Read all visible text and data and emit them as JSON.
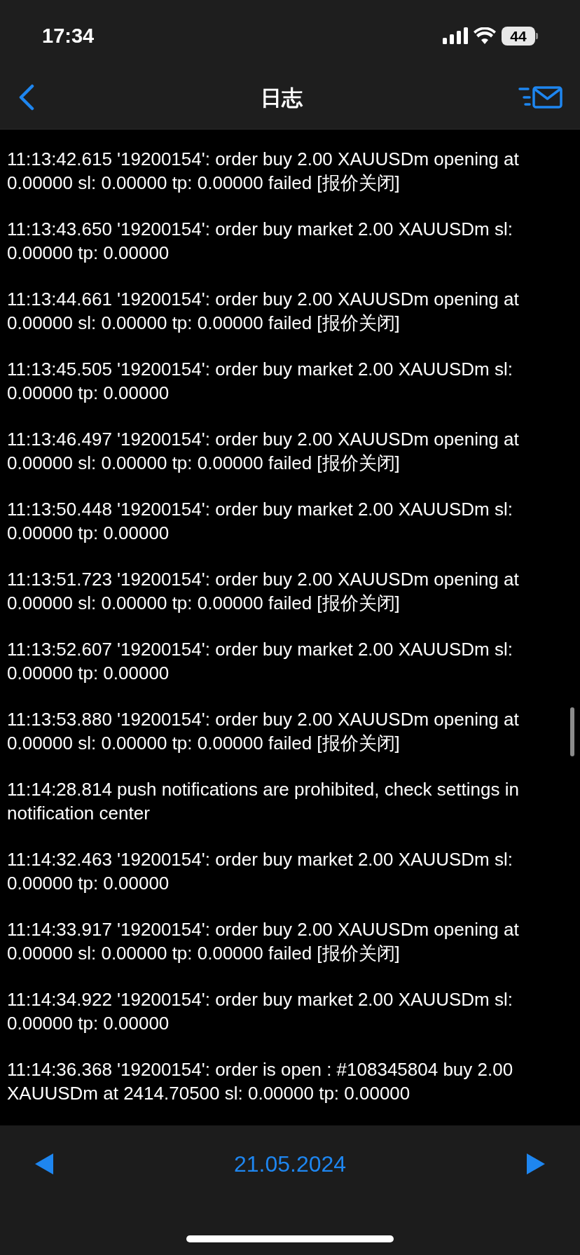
{
  "status_bar": {
    "time": "17:34",
    "battery": "44"
  },
  "nav": {
    "title": "日志"
  },
  "log": [
    {
      "text": "11:13:42.615 '19200154': order buy 2.00 XAUUSDm opening at 0.00000 sl: 0.00000 tp: 0.00000 failed [报价关闭]"
    },
    {
      "text": "11:13:43.650 '19200154': order buy market 2.00 XAUUSDm sl: 0.00000 tp: 0.00000"
    },
    {
      "text": "11:13:44.661 '19200154': order buy 2.00 XAUUSDm opening at 0.00000 sl: 0.00000 tp: 0.00000 failed [报价关闭]"
    },
    {
      "text": "11:13:45.505 '19200154': order buy market 2.00 XAUUSDm sl: 0.00000 tp: 0.00000"
    },
    {
      "text": "11:13:46.497 '19200154': order buy 2.00 XAUUSDm opening at 0.00000 sl: 0.00000 tp: 0.00000 failed [报价关闭]"
    },
    {
      "text": "11:13:50.448 '19200154': order buy market 2.00 XAUUSDm sl: 0.00000 tp: 0.00000"
    },
    {
      "text": "11:13:51.723 '19200154': order buy 2.00 XAUUSDm opening at 0.00000 sl: 0.00000 tp: 0.00000 failed [报价关闭]"
    },
    {
      "text": "11:13:52.607 '19200154': order buy market 2.00 XAUUSDm sl: 0.00000 tp: 0.00000"
    },
    {
      "text": "11:13:53.880 '19200154': order buy 2.00 XAUUSDm opening at 0.00000 sl: 0.00000 tp: 0.00000 failed [报价关闭]"
    },
    {
      "text": "11:14:28.814 push notifications are prohibited, check settings in notification center"
    },
    {
      "text": "11:14:32.463 '19200154': order buy market 2.00 XAUUSDm sl: 0.00000 tp: 0.00000"
    },
    {
      "text": "11:14:33.917 '19200154': order buy 2.00 XAUUSDm opening at 0.00000 sl: 0.00000 tp: 0.00000 failed [报价关闭]"
    },
    {
      "text": "11:14:34.922 '19200154': order buy market 2.00 XAUUSDm sl: 0.00000 tp: 0.00000"
    },
    {
      "text": "11:14:36.368 '19200154': order is open : #108345804 buy 2.00 XAUUSDm at 2414.70500 sl: 0.00000 tp: 0.00000"
    }
  ],
  "footer": {
    "date": "21.05.2024"
  }
}
